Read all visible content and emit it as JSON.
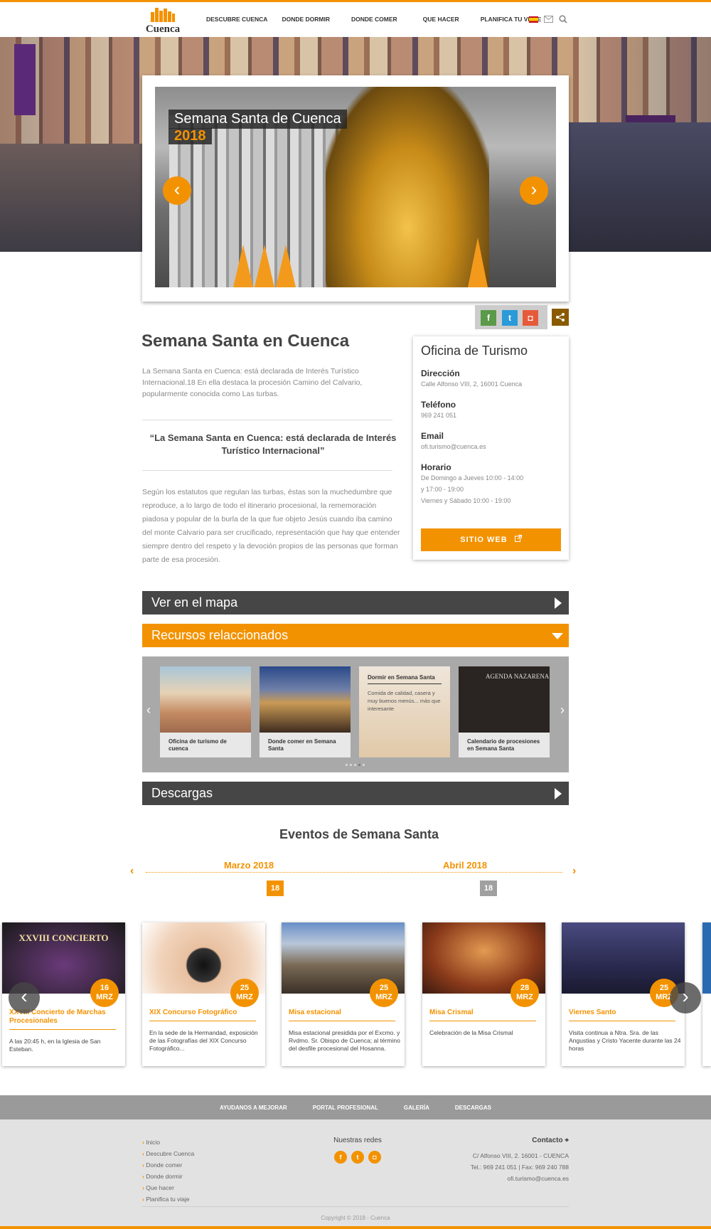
{
  "header": {
    "logo_text": "Cuenca",
    "nav": [
      "DESCUBRE CUENCA",
      "DONDE DORMIR",
      "DONDE COMER",
      "QUE HACER",
      "PLANIFICA TU VIAJE"
    ]
  },
  "slider": {
    "title": "Semana Santa de Cuenca",
    "year": "2018",
    "prev": "‹",
    "next": "›"
  },
  "share": {
    "facebook": "f",
    "twitter": "t",
    "instagram": "◘"
  },
  "article": {
    "title": "Semana Santa en Cuenca",
    "intro": "La Semana Santa en Cuenca: está declarada de Interés Turístico Internacional.18 En ella destaca la procesión Camino del Calvario, popularmente conocida como Las turbas.",
    "quote": "“La Semana Santa en Cuenca: está declarada de Interés Turístico Internacional”",
    "body": "Según los estatutos que regulan las turbas, éstas son la muchedumbre que reproduce, a lo largo de todo el itinerario procesional, la rememoración piadosa y popular de la burla de la que fue objeto Jesús cuando iba camino del monte Calvario para ser crucificado, representación que hay que entender siempre dentro del respeto y la devoción propios de las personas que forman parte de esa procesión."
  },
  "office": {
    "title": "Oficina de Turismo",
    "address_label": "Dirección",
    "address": "Calle Alfonso VIII, 2, 16001 Cuenca",
    "phone_label": "Teléfono",
    "phone": "969 241 051",
    "email_label": "Email",
    "email": "ofi.turismo@cuenca.es",
    "hours_label": "Horario",
    "hours1": "De Domingo a Jueves 10:00 - 14:00",
    "hours2": "y 17:00 - 19:00",
    "hours3": "Viernes y Sábado 10:00 - 19:00",
    "web_button": "SITIO WEB"
  },
  "sections": {
    "map": "Ver en el mapa",
    "resources": "Recursos relaccionados",
    "downloads": "Descargas"
  },
  "resources": [
    {
      "caption": "Oficina de turismo de cuenca"
    },
    {
      "caption": "Donde comer en Semana Santa"
    },
    {
      "caption": "",
      "overlay_title": "Dormir en Semana Santa",
      "overlay_text": "Comida de calidad, casera y muy buenos menús... más que interesante"
    },
    {
      "caption": "Calendario de procesiones en Semana Santa",
      "img_text": "AGENDA NAZARENA"
    }
  ],
  "events": {
    "title": "Eventos de Semana Santa",
    "months": [
      "Marzo 2018",
      "Abril 2018"
    ],
    "month_days": [
      "18",
      "18"
    ],
    "items": [
      {
        "day": "16",
        "month": "MRZ",
        "title": "XXVIII Concierto de Marchas Procesionales",
        "desc": "A las 20:45 h, en la Iglesia de San Esteban.",
        "img_text": "XXVIII CONCIERTO"
      },
      {
        "day": "25",
        "month": "MRZ",
        "title": "XIX Concurso Fotográfico",
        "desc": "En la sede de la Hermandad, exposición de las Fotografías del XIX Concurso Fotográfico..."
      },
      {
        "day": "25",
        "month": "MRZ",
        "title": "Misa estacional",
        "desc": "Misa estacional presidida por el Excmo. y Rvdmo. Sr. Obispo de Cuenca; al término del desfile procesional del Hosanna."
      },
      {
        "day": "28",
        "month": "MRZ",
        "title": "Misa Crismal",
        "desc": "Celebración de la Misa Crismal"
      },
      {
        "day": "25",
        "month": "MRZ",
        "title": "Viernes Santo",
        "desc": "Visita continua a Ntra. Sra. de las Angustias y Cristo Yacente durante las 24 horas"
      }
    ]
  },
  "footer_nav": [
    "AYUDANOS A MEJORAR",
    "PORTAL PROFESIONAL",
    "GALERÍA",
    "DESCARGAS"
  ],
  "footer": {
    "links": [
      "Inicio",
      "Descubre Cuenca",
      "Donde comer",
      "Donde dormir",
      "Que hacer",
      "Planifica tu viaje"
    ],
    "social_title": "Nuestras redes",
    "contact_title": "Contacto",
    "contact1": "C/ Alfonso VIII, 2. 16001 - CUENCA",
    "contact2": "Tel.: 969 241 051 | Fax: 969 240 788",
    "contact3": "ofi.turismo@cuenca.es",
    "copyright": "Copyright © 2018 - Cuenca"
  },
  "colors": {
    "accent": "#f39200",
    "dark_bar": "#464646",
    "footer_nav": "#9a9a9a"
  }
}
